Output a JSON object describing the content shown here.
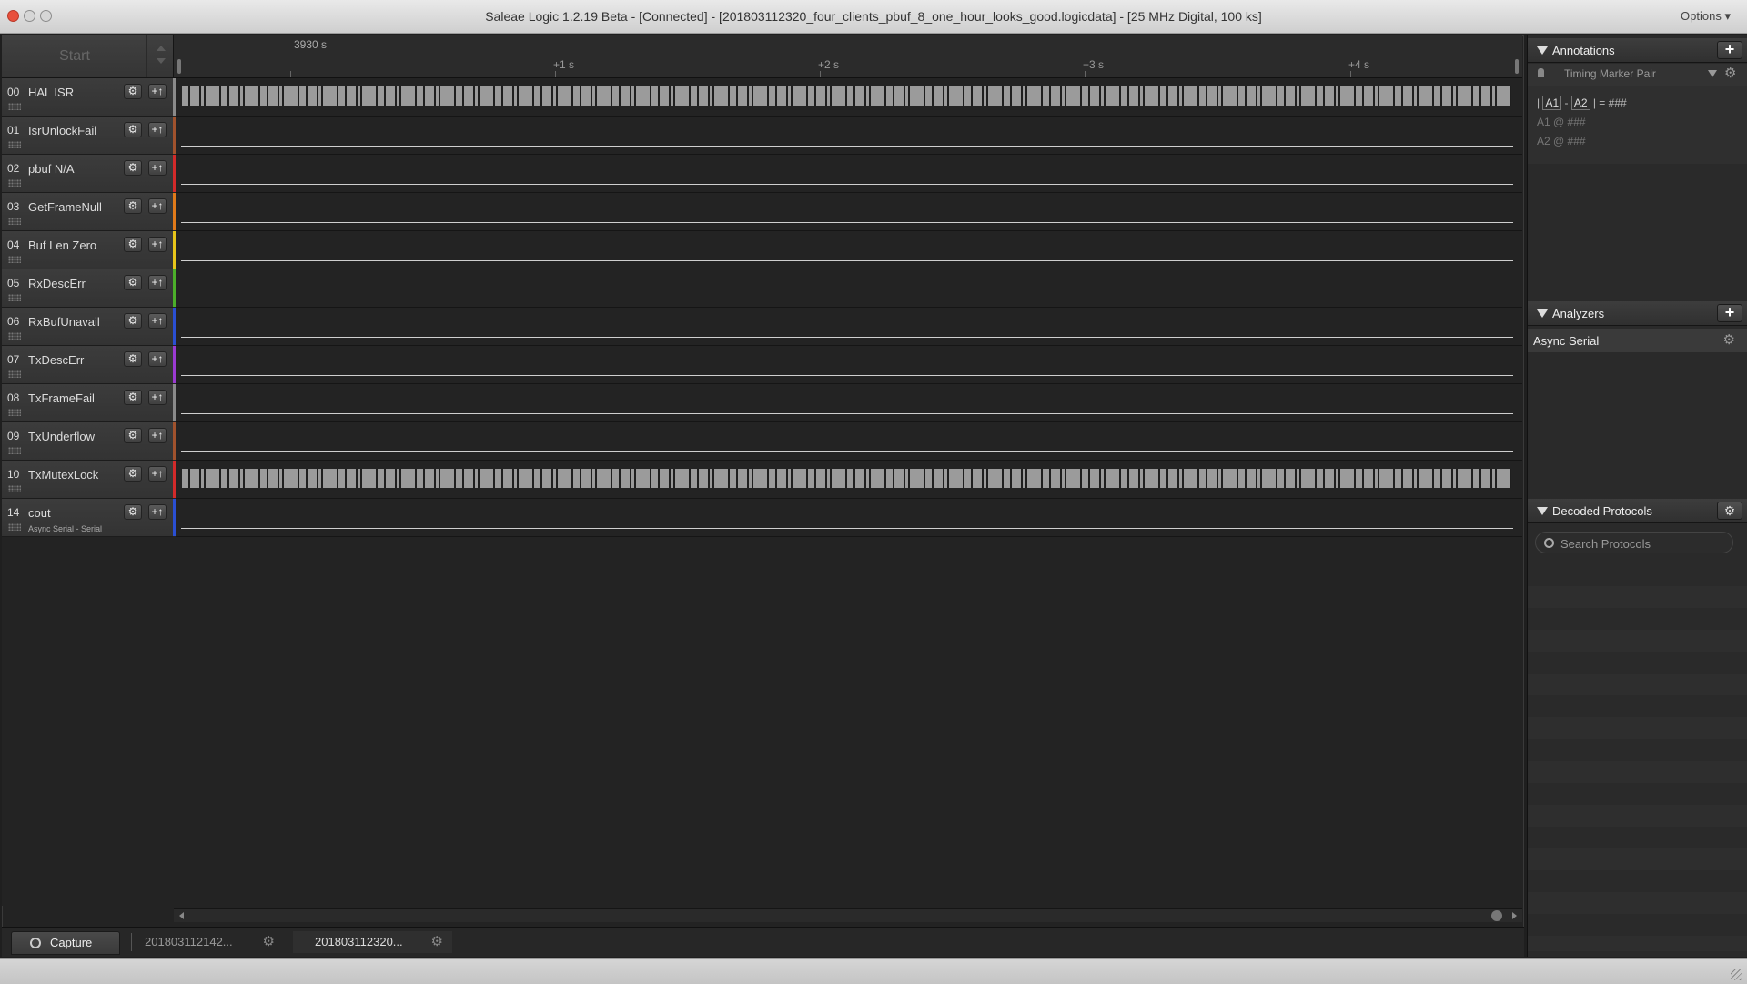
{
  "window": {
    "title": "Saleae Logic 1.2.19 Beta - [Connected] - [201803112320_four_clients_pbuf_8_one_hour_looks_good.logicdata] - [25 MHz Digital, 100 ks]",
    "options_label": "Options ▾"
  },
  "timeline": {
    "start_label": "Start",
    "origin_label": "3930 s",
    "ticks": [
      "+1 s",
      "+2 s",
      "+3 s",
      "+4 s"
    ]
  },
  "channels": [
    {
      "num": "00",
      "name": "HAL ISR",
      "sub": "",
      "color": "#8a8a8a",
      "signal": "pulses"
    },
    {
      "num": "01",
      "name": "IsrUnlockFail",
      "sub": "",
      "color": "#a0522d",
      "signal": "flat"
    },
    {
      "num": "02",
      "name": "pbuf N/A",
      "sub": "",
      "color": "#d22a2a",
      "signal": "flat"
    },
    {
      "num": "03",
      "name": "GetFrameNull",
      "sub": "",
      "color": "#e07a1a",
      "signal": "flat"
    },
    {
      "num": "04",
      "name": "Buf Len Zero",
      "sub": "",
      "color": "#e8c51a",
      "signal": "flat"
    },
    {
      "num": "05",
      "name": "RxDescErr",
      "sub": "",
      "color": "#4caf2a",
      "signal": "flat"
    },
    {
      "num": "06",
      "name": "RxBufUnavail",
      "sub": "",
      "color": "#2a4fd2",
      "signal": "flat"
    },
    {
      "num": "07",
      "name": "TxDescErr",
      "sub": "",
      "color": "#9b3ad2",
      "signal": "flat"
    },
    {
      "num": "08",
      "name": "TxFrameFail",
      "sub": "",
      "color": "#8a8a8a",
      "signal": "flat"
    },
    {
      "num": "09",
      "name": "TxUnderflow",
      "sub": "",
      "color": "#a0522d",
      "signal": "flat"
    },
    {
      "num": "10",
      "name": "TxMutexLock",
      "sub": "",
      "color": "#d22a2a",
      "signal": "pulses"
    },
    {
      "num": "14",
      "name": "cout",
      "sub": "Async Serial - Serial",
      "color": "#2a4fd2",
      "signal": "flat"
    }
  ],
  "channel_buttons": {
    "gear": "⚙",
    "plus": "+↑"
  },
  "tabs": {
    "capture": "Capture",
    "t1": "201803112142...",
    "t2": "201803112320...",
    "gear": "⚙"
  },
  "annotations": {
    "header": "Annotations",
    "add": "+",
    "marker_pair": "Timing Marker Pair",
    "gear": "⚙",
    "a1": "A1",
    "a2": "A2",
    "diff_value": "= ###",
    "a1_line": "A1  @  ###",
    "a2_line": "A2  @  ###"
  },
  "analyzers": {
    "header": "Analyzers",
    "add": "+",
    "items": [
      "Async Serial"
    ],
    "gear": "⚙"
  },
  "decoded": {
    "header": "Decoded Protocols",
    "gear": "⚙",
    "search_placeholder": "Search Protocols"
  }
}
